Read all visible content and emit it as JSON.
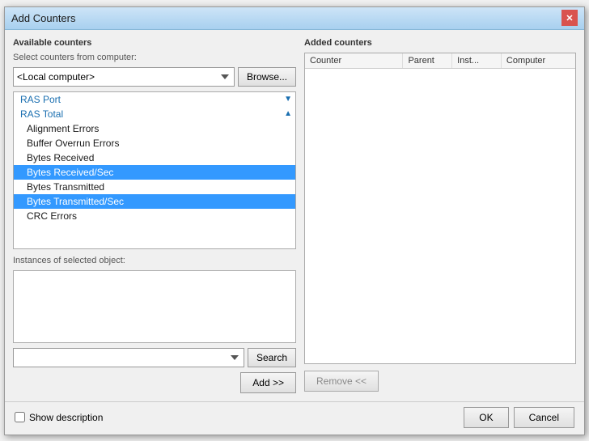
{
  "dialog": {
    "title": "Add Counters",
    "close_label": "✕"
  },
  "left_panel": {
    "available_counters_label": "Available counters",
    "select_from_label": "Select counters from computer:",
    "computer_value": "<Local computer>",
    "browse_label": "Browse...",
    "counters": [
      {
        "id": "ras-port-header",
        "label": "RAS Port",
        "type": "group",
        "expanded": false
      },
      {
        "id": "ras-total-header",
        "label": "RAS Total",
        "type": "group",
        "expanded": true
      },
      {
        "id": "alignment-errors",
        "label": "Alignment Errors",
        "type": "item",
        "indented": true
      },
      {
        "id": "buffer-overrun-errors",
        "label": "Buffer Overrun Errors",
        "type": "item",
        "indented": true
      },
      {
        "id": "bytes-received",
        "label": "Bytes Received",
        "type": "item",
        "indented": true
      },
      {
        "id": "bytes-received-sec",
        "label": "Bytes Received/Sec",
        "type": "item",
        "indented": true,
        "selected": true
      },
      {
        "id": "bytes-transmitted",
        "label": "Bytes Transmitted",
        "type": "item",
        "indented": true
      },
      {
        "id": "bytes-transmitted-sec",
        "label": "Bytes Transmitted/Sec",
        "type": "item",
        "indented": true,
        "selected": true
      },
      {
        "id": "crc-errors",
        "label": "CRC Errors",
        "type": "item",
        "indented": true
      }
    ],
    "instances_label": "Instances of selected object:",
    "search_placeholder": "",
    "search_label": "Search",
    "add_label": "Add >>"
  },
  "right_panel": {
    "added_counters_label": "Added counters",
    "table_headers": [
      "Counter",
      "Parent",
      "Inst...",
      "Computer"
    ],
    "remove_label": "Remove <<"
  },
  "footer": {
    "show_description_label": "Show description",
    "ok_label": "OK",
    "cancel_label": "Cancel"
  }
}
